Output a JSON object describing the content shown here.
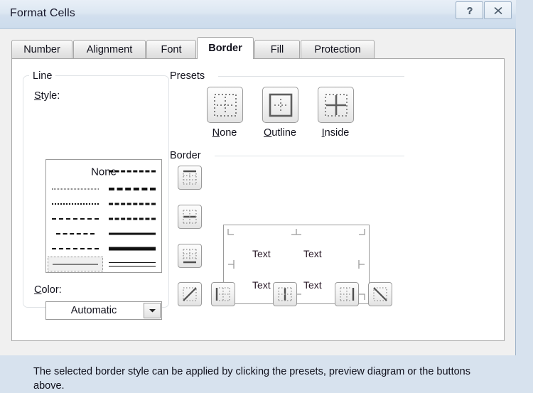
{
  "window": {
    "title": "Format Cells",
    "help_button": "?",
    "close_button": "✕",
    "help_icon": "question-mark-icon",
    "close_icon": "close-x-icon"
  },
  "tabs": [
    {
      "label": "Number",
      "active": false
    },
    {
      "label": "Alignment",
      "active": false
    },
    {
      "label": "Font",
      "active": false
    },
    {
      "label": "Border",
      "active": true
    },
    {
      "label": "Fill",
      "active": false
    },
    {
      "label": "Protection",
      "active": false
    }
  ],
  "line_group": {
    "title": "Line",
    "style_label": "Style:",
    "style_accel": "S",
    "none_label": "None",
    "styles": [
      {
        "name": "none",
        "column": "left",
        "row": 0,
        "selected": false
      },
      {
        "name": "fine-dotted",
        "column": "left",
        "row": 1,
        "selected": false
      },
      {
        "name": "dotted",
        "column": "left",
        "row": 2,
        "selected": false
      },
      {
        "name": "dashed-wide",
        "column": "left",
        "row": 3,
        "selected": false
      },
      {
        "name": "dash-dot",
        "column": "left",
        "row": 4,
        "selected": false
      },
      {
        "name": "dashed-fine",
        "column": "left",
        "row": 5,
        "selected": false
      },
      {
        "name": "thin-solid",
        "column": "left",
        "row": 6,
        "selected": true
      },
      {
        "name": "dash-dot-thick",
        "column": "right",
        "row": 0,
        "selected": false
      },
      {
        "name": "slant-dash-dot",
        "column": "right",
        "row": 1,
        "selected": false
      },
      {
        "name": "medium-dash-dot",
        "column": "right",
        "row": 2,
        "selected": false
      },
      {
        "name": "medium-dashed",
        "column": "right",
        "row": 3,
        "selected": false
      },
      {
        "name": "medium-solid",
        "column": "right",
        "row": 4,
        "selected": false
      },
      {
        "name": "thick-solid",
        "column": "right",
        "row": 5,
        "selected": false
      },
      {
        "name": "double-line",
        "column": "right",
        "row": 6,
        "selected": false
      }
    ],
    "color_label": "Color:",
    "color_accel": "C",
    "color_value": "Automatic",
    "color_dropdown_icon": "chevron-down-icon"
  },
  "presets": {
    "title": "Presets",
    "buttons": [
      {
        "label": "None",
        "accel": "N",
        "icon": "border-none-icon"
      },
      {
        "label": "Outline",
        "accel": "O",
        "icon": "border-outline-icon"
      },
      {
        "label": "Inside",
        "accel": "I",
        "icon": "border-inside-icon"
      }
    ]
  },
  "border": {
    "title": "Border",
    "left_buttons": [
      {
        "name": "border-top-button",
        "icon": "border-top-icon"
      },
      {
        "name": "border-inside-horizontal-button",
        "icon": "border-inside-horizontal-icon"
      },
      {
        "name": "border-bottom-button",
        "icon": "border-bottom-icon"
      }
    ],
    "bottom_buttons": [
      {
        "name": "border-diagonal-up-button",
        "icon": "border-diagonal-up-icon"
      },
      {
        "name": "border-left-button",
        "icon": "border-left-icon"
      },
      {
        "name": "border-inside-vertical-button",
        "icon": "border-inside-vertical-icon"
      },
      {
        "name": "border-right-button",
        "icon": "border-right-icon"
      },
      {
        "name": "border-diagonal-down-button",
        "icon": "border-diagonal-down-icon"
      }
    ],
    "preview_texts": [
      "Text",
      "Text",
      "Text",
      "Text"
    ]
  },
  "note": "The selected border style can be applied by clicking the presets, preview diagram or the buttons above.",
  "colors": {
    "titlebar": "#dce7f2",
    "dialog_bg": "#f0f0f0",
    "panel_bg": "#ffffff",
    "outside_bg": "#d7e2ee",
    "text": "#11111c",
    "border_gray": "#9a9a9a",
    "group_line": "#dfe3e6"
  }
}
